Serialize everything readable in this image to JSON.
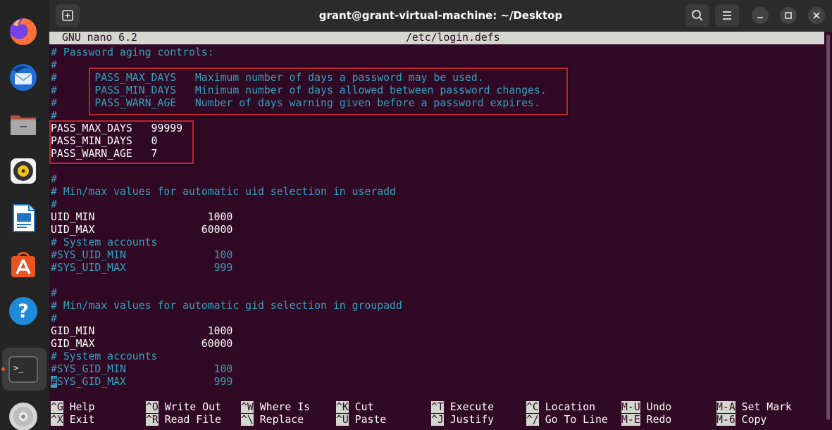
{
  "window": {
    "title": "grant@grant-virtual-machine: ~/Desktop"
  },
  "dock": {
    "items": [
      {
        "name": "firefox",
        "icon": "firefox-icon"
      },
      {
        "name": "thunderbird",
        "icon": "thunderbird-icon"
      },
      {
        "name": "files",
        "icon": "files-icon"
      },
      {
        "name": "rhythmbox",
        "icon": "rhythmbox-icon"
      },
      {
        "name": "libreoffice-writer",
        "icon": "writer-icon"
      },
      {
        "name": "app-center",
        "icon": "app-center-icon"
      },
      {
        "name": "help",
        "icon": "help-icon",
        "glyph": "?"
      },
      {
        "name": "terminal",
        "icon": "terminal-icon",
        "glyph": ">_"
      },
      {
        "name": "disc",
        "icon": "disc-icon"
      }
    ]
  },
  "nano": {
    "version": "GNU nano 6.2",
    "filename": "/etc/login.defs"
  },
  "lines": [
    "# Password aging controls:",
    "#",
    "#      PASS_MAX_DAYS   Maximum number of days a password may be used.",
    "#      PASS_MIN_DAYS   Minimum number of days allowed between password changes.",
    "#      PASS_WARN_AGE   Number of days warning given before a password expires.",
    "#",
    "PASS_MAX_DAYS   99999",
    "PASS_MIN_DAYS   0",
    "PASS_WARN_AGE   7",
    "",
    "#",
    "# Min/max values for automatic uid selection in useradd",
    "#",
    "UID_MIN                  1000",
    "UID_MAX                 60000",
    "# System accounts",
    "#SYS_UID_MIN              100",
    "#SYS_UID_MAX              999",
    "",
    "#",
    "# Min/max values for automatic gid selection in groupadd",
    "#",
    "GID_MIN                  1000",
    "GID_MAX                 60000",
    "# System accounts",
    "#SYS_GID_MIN              100",
    "SYS_GID_MAX              999"
  ],
  "cursor_char": "#",
  "help": [
    {
      "key": "^G",
      "label": "Help"
    },
    {
      "key": "^O",
      "label": "Write Out"
    },
    {
      "key": "^W",
      "label": "Where Is"
    },
    {
      "key": "^K",
      "label": "Cut"
    },
    {
      "key": "^T",
      "label": "Execute"
    },
    {
      "key": "^C",
      "label": "Location"
    },
    {
      "key": "M-U",
      "label": "Undo"
    },
    {
      "key": "M-A",
      "label": "Set Mark"
    },
    {
      "key": "^X",
      "label": "Exit"
    },
    {
      "key": "^R",
      "label": "Read File"
    },
    {
      "key": "^\\",
      "label": "Replace"
    },
    {
      "key": "^U",
      "label": "Paste"
    },
    {
      "key": "^J",
      "label": "Justify"
    },
    {
      "key": "^/",
      "label": "Go To Line"
    },
    {
      "key": "M-E",
      "label": "Redo"
    },
    {
      "key": "M-6",
      "label": "Copy"
    }
  ],
  "colors": {
    "terminal_bg": "#300a24",
    "comment": "#34a0bd",
    "text": "#ffffff",
    "highlight_box": "#c0242f",
    "accent": "#e95420"
  }
}
